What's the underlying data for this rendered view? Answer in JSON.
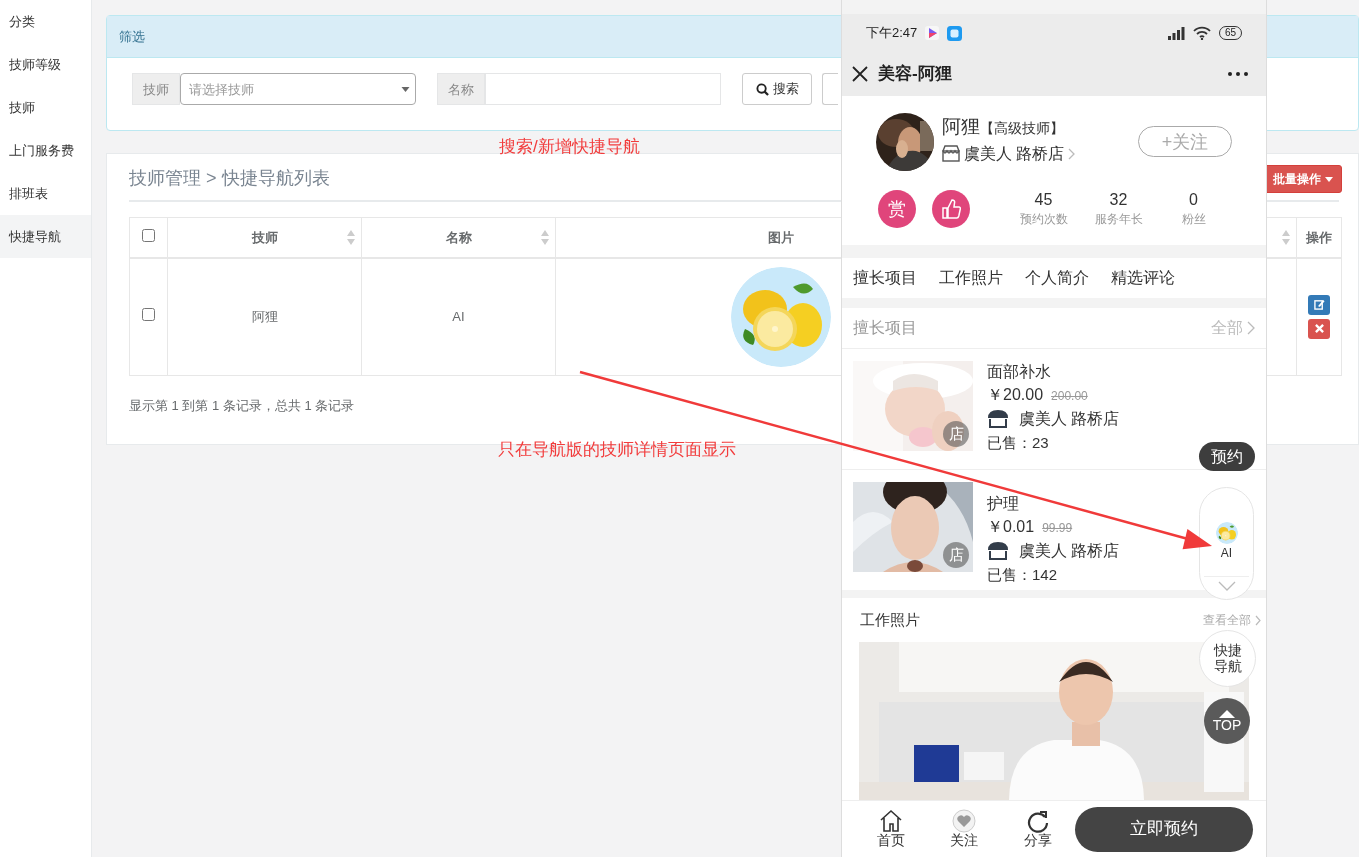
{
  "sidebar": {
    "items": [
      {
        "label": "分类",
        "selected": false
      },
      {
        "label": "技师等级",
        "selected": false
      },
      {
        "label": "技师",
        "selected": false
      },
      {
        "label": "上门服务费",
        "selected": false
      },
      {
        "label": "排班表",
        "selected": false
      },
      {
        "label": "快捷导航",
        "selected": true
      }
    ]
  },
  "filter": {
    "title": "筛选",
    "fields": [
      {
        "kind": "select",
        "label": "技师",
        "placeholder": "请选择技师"
      },
      {
        "kind": "text",
        "label": "名称"
      }
    ],
    "search_button": "搜索"
  },
  "annotations": [
    "搜索/新增快捷导航",
    "只在导航版的技师详情页面显示"
  ],
  "list": {
    "breadcrumb": "技师管理 > 快捷导航列表",
    "batch_button": "批量操作",
    "table": {
      "all_selected": false,
      "columns": [
        {
          "label": "技师",
          "sortable": true
        },
        {
          "label": "名称",
          "sortable": true
        },
        {
          "label": "图片",
          "sortable": false
        },
        {
          "sortable": true
        },
        {
          "label": "操作",
          "sortable": false
        }
      ],
      "rows": [
        {
          "selected": false,
          "technician": "阿狸",
          "name": "AI",
          "image": {
            "kind": "picture"
          },
          "actions": [
            {
              "kind": "edit"
            },
            {
              "kind": "delete"
            }
          ]
        }
      ]
    },
    "info": "显示第 1 到第 1 条记录，总共 1 条记录"
  },
  "phone": {
    "status_bar": {
      "time": "下午2:47",
      "battery": "65"
    },
    "title": "美容-阿狸",
    "profile": {
      "name": "阿狸",
      "level": "【高级技师】",
      "store": "虞美人 路桥店",
      "follow_button": "+关注",
      "reward_button": "赏",
      "stats": [
        {
          "value": "45",
          "label": "预约次数"
        },
        {
          "value": "32",
          "label": "服务年长"
        },
        {
          "value": "0",
          "label": "粉丝"
        }
      ]
    },
    "tabs": [
      {
        "label": "擅长项目"
      },
      {
        "label": "工作照片"
      },
      {
        "label": "个人简介"
      },
      {
        "label": "精选评论"
      }
    ],
    "services": {
      "title": "擅长项目",
      "more": "全部",
      "items": [
        {
          "name": "面部补水",
          "price": "￥20.00",
          "original_price": "200.00",
          "store": "虞美人 路桥店",
          "sold": "已售：23",
          "badge": "店",
          "book_button": "预约"
        },
        {
          "name": "护理",
          "price": "￥0.01",
          "original_price": "99.99",
          "store": "虞美人 路桥店",
          "sold": "已售：142",
          "badge": "店"
        }
      ]
    },
    "photos": {
      "title": "工作照片",
      "more": "查看全部"
    },
    "floating": {
      "nav_items": [
        {
          "label": "AI"
        }
      ],
      "quick_nav": "快捷导航",
      "top": "TOP"
    },
    "footer": {
      "items": [
        {
          "kind": "home",
          "label": "首页"
        },
        {
          "kind": "heart",
          "label": "关注"
        },
        {
          "kind": "share",
          "label": "分享"
        }
      ],
      "book_button": "立即预约"
    }
  }
}
